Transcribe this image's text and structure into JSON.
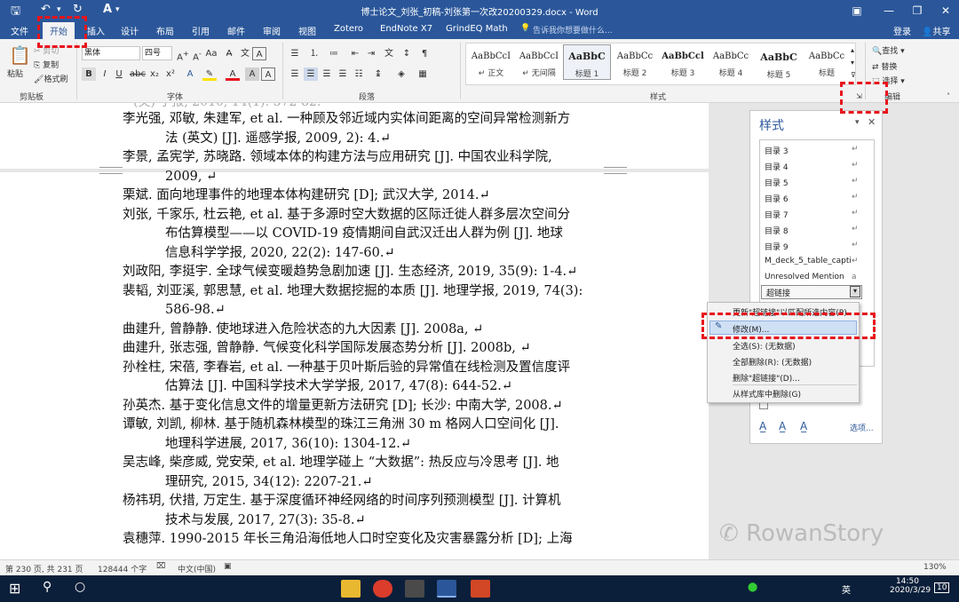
{
  "title_bar": {
    "title": "博士论文_刘张_初稿-刘张第一次改20200329.docx - Word"
  },
  "tabs": [
    {
      "label": "文件"
    },
    {
      "label": "开始"
    },
    {
      "label": "插入"
    },
    {
      "label": "设计"
    },
    {
      "label": "布局"
    },
    {
      "label": "引用"
    },
    {
      "label": "邮件"
    },
    {
      "label": "审阅"
    },
    {
      "label": "视图"
    },
    {
      "label": "Zotero"
    },
    {
      "label": "EndNote X7"
    },
    {
      "label": "GrindEQ Math"
    }
  ],
  "tell_me": "告诉我你想要做什么...",
  "account": {
    "login": "登录",
    "share": "共享"
  },
  "ribbon": {
    "clipboard": {
      "paste": "粘贴",
      "cut": "剪切",
      "copy": "复制",
      "format_painter": "格式刷",
      "label": "剪贴板"
    },
    "font": {
      "family": "黑体",
      "size": "四号",
      "label": "字体"
    },
    "paragraph": {
      "label": "段落"
    },
    "styles": {
      "label": "样式",
      "items": [
        {
          "preview": "AaBbCcI",
          "name": "↵ 正文"
        },
        {
          "preview": "AaBbCcI",
          "name": "↵ 无间隔"
        },
        {
          "preview": "AaBbC",
          "name": "标题 1"
        },
        {
          "preview": "AaBbCc",
          "name": "标题 2"
        },
        {
          "preview": "AaBbCcl",
          "name": "标题 3"
        },
        {
          "preview": "AaBbCc",
          "name": "标题 4"
        },
        {
          "preview": "AaBbC",
          "name": "标题 5"
        },
        {
          "preview": "AaBbCc",
          "name": "标题"
        }
      ]
    },
    "editing": {
      "find": "查找",
      "replace": "替换",
      "select": "选择",
      "label": "编辑"
    }
  },
  "document": {
    "lines": [
      {
        "text": "李光强, 邓敏, 朱建军, et al. 一种顾及邻近域内实体间距离的空间异常检测新方",
        "indent": false
      },
      {
        "text": "法 (英文) [J]. 遥感学报, 2009, 2): 4.↵",
        "indent": true
      },
      {
        "text": "李景, 孟宪学, 苏晓路. 领域本体的构建方法与应用研究 [J]. 中国农业科学院,",
        "indent": false
      },
      {
        "text": "2009, ↵",
        "indent": true
      },
      {
        "text": "栗斌. 面向地理事件的地理本体构建研究 [D]; 武汉大学, 2014.↵",
        "indent": false
      },
      {
        "text": "刘张, 千家乐, 杜云艳, et al. 基于多源时空大数据的区际迁徙人群多层次空间分",
        "indent": false
      },
      {
        "text": "布估算模型——以 COVID-19 疫情期间自武汉迁出人群为例 [J]. 地球",
        "indent": true
      },
      {
        "text": "信息科学学报, 2020, 22(2): 147-60.↵",
        "indent": true
      },
      {
        "text": "刘政阳, 李挺宇. 全球气候变暖趋势急剧加速 [J]. 生态经济, 2019, 35(9): 1-4.↵",
        "indent": false
      },
      {
        "text": "裴韬, 刘亚溪, 郭思慧, et al. 地理大数据挖掘的本质 [J]. 地理学报, 2019, 74(3):",
        "indent": false
      },
      {
        "text": "586-98.↵",
        "indent": true
      },
      {
        "text": "曲建升, 曾静静. 使地球进入危险状态的九大因素 [J]. 2008a, ↵",
        "indent": false
      },
      {
        "text": "曲建升, 张志强, 曾静静. 气候变化科学国际发展态势分析 [J]. 2008b, ↵",
        "indent": false
      },
      {
        "text": "孙栓柱, 宋蓓, 李春岩, et al. 一种基于贝叶斯后验的异常值在线检测及置信度评",
        "indent": false
      },
      {
        "text": "估算法 [J]. 中国科学技术大学学报, 2017, 47(8): 644-52.↵",
        "indent": true
      },
      {
        "text": "孙英杰. 基于变化信息文件的增量更新方法研究 [D]; 长沙: 中南大学, 2008.↵",
        "indent": false
      },
      {
        "text": "谭敏, 刘凯, 柳林. 基于随机森林模型的珠江三角洲 30 m 格网人口空间化 [J].",
        "indent": false
      },
      {
        "text": "地理科学进展, 2017, 36(10): 1304-12.↵",
        "indent": true
      },
      {
        "text": "吴志峰, 柴彦威, 党安荣, et al. 地理学碰上 “大数据”: 热反应与冷思考 [J]. 地",
        "indent": false
      },
      {
        "text": "理研究, 2015, 34(12): 2207-21.↵",
        "indent": true
      },
      {
        "text": "杨祎玥, 伏措, 万定生. 基于深度循环神经网络的时间序列预测模型 [J]. 计算机",
        "indent": false
      },
      {
        "text": "技术与发展, 2017, 27(3): 35-8.↵",
        "indent": true
      },
      {
        "text": "袁穗萍. 1990-2015 年长三角沿海低地人口时空变化及灾害暴露分析 [D]; 上海",
        "indent": false
      }
    ]
  },
  "styles_pane": {
    "title": "样式",
    "items": [
      "目录 3",
      "目录 4",
      "目录 5",
      "目录 6",
      "目录 7",
      "目录 8",
      "目录 9",
      "M_deck_5_table_capti",
      "Unresolved Mention",
      "超链接"
    ],
    "item_marks": [
      "↵",
      "↵",
      "↵",
      "↵",
      "↵",
      "↵",
      "↵",
      "↵",
      "a",
      ""
    ],
    "options": "选项..."
  },
  "context_menu": {
    "items": [
      "更新\"超链接\"以匹配所选内容(P)",
      "修改(M)...",
      "全选(S): (无数据)",
      "全部删除(R): (无数据)",
      "删除\"超链接\"(D)...",
      "从样式库中删除(G)"
    ]
  },
  "status_bar": {
    "page": "第 230 页, 共 231 页",
    "words": "128444 个字",
    "language": "中文(中国)",
    "zoom": "130%"
  },
  "watermark": "RowanStory",
  "taskbar": {
    "time": "14:50",
    "date": "2020/3/29",
    "ime": "英",
    "notifications": "10"
  },
  "colors": {
    "word_blue": "#2b579a",
    "highlight_red": "#e8141c",
    "taskbar": "#0b1f3a"
  }
}
